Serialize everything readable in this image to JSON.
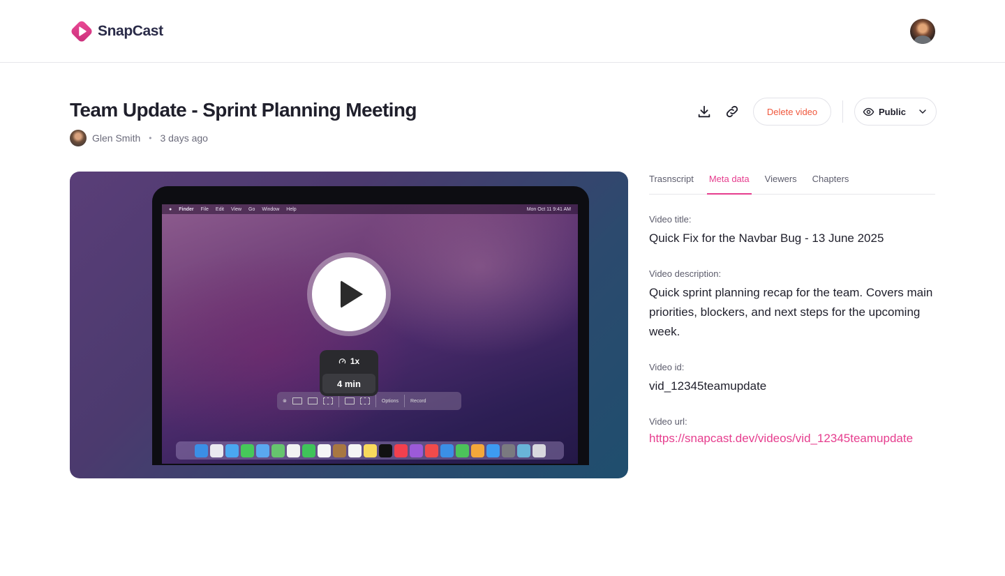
{
  "brand": {
    "name": "SnapCast",
    "accent": "#e63d8e"
  },
  "header": {
    "avatar_icon": "user-avatar"
  },
  "video": {
    "title": "Team Update - Sprint Planning Meeting",
    "author": "Glen Smith",
    "separator": "•",
    "posted": "3 days ago"
  },
  "actions": {
    "download_icon": "download-icon",
    "link_icon": "link-icon",
    "delete_label": "Delete video",
    "visibility_label": "Public"
  },
  "player": {
    "speed": "1x",
    "duration": "4 min",
    "menubar": {
      "app": "Finder",
      "items": [
        "File",
        "Edit",
        "View",
        "Go",
        "Window",
        "Help"
      ],
      "clock": "Mon Oct 11  9:41 AM"
    },
    "toolbar": {
      "options": "Options",
      "record": "Record"
    }
  },
  "tabs": [
    {
      "label": "Trasnscript",
      "active": false
    },
    {
      "label": "Meta data",
      "active": true
    },
    {
      "label": "Viewers",
      "active": false
    },
    {
      "label": "Chapters",
      "active": false
    }
  ],
  "metadata": {
    "title_label": "Video title:",
    "title_value": "Quick Fix for the Navbar Bug - 13 June 2025",
    "description_label": "Video description:",
    "description_value": "Quick sprint planning recap for the team. Covers main priorities, blockers, and next steps for the upcoming week.",
    "id_label": "Video id:",
    "id_value": "vid_12345teamupdate",
    "url_label": "Video url:",
    "url_value": "https://snapcast.dev/videos/vid_12345teamupdate"
  }
}
